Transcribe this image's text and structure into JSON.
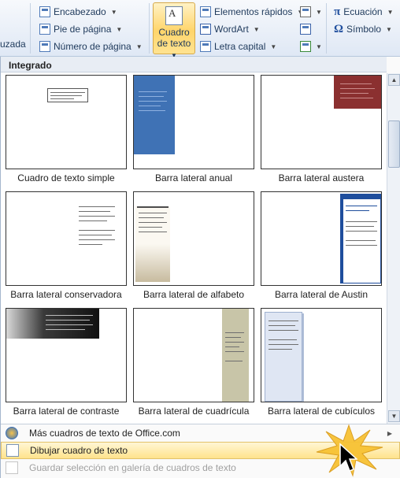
{
  "ribbon": {
    "partial_left_label": "uzada",
    "header_footer": [
      {
        "label": "Encabezado",
        "icon": "header-icon"
      },
      {
        "label": "Pie de página",
        "icon": "footer-icon"
      },
      {
        "label": "Número de página",
        "icon": "page-number-icon"
      }
    ],
    "text_box_button": {
      "line1": "Cuadro",
      "line2": "de texto"
    },
    "text_group": [
      {
        "label": "Elementos rápidos",
        "icon": "quick-parts-icon"
      },
      {
        "label": "WordArt",
        "icon": "wordart-icon"
      },
      {
        "label": "Letra capital",
        "icon": "drop-cap-icon"
      }
    ],
    "symbols": [
      {
        "label": "Ecuación",
        "glyph": "π"
      },
      {
        "label": "Símbolo",
        "glyph": "Ω"
      }
    ]
  },
  "gallery": {
    "section_title": "Integrado",
    "tiles": [
      {
        "label": "Cuadro de texto simple"
      },
      {
        "label": "Barra lateral anual"
      },
      {
        "label": "Barra lateral austera"
      },
      {
        "label": "Barra lateral conservadora"
      },
      {
        "label": "Barra lateral de alfabeto"
      },
      {
        "label": "Barra lateral de Austin"
      },
      {
        "label": "Barra lateral de contraste"
      },
      {
        "label": "Barra lateral de cuadrícula"
      },
      {
        "label": "Barra lateral de cubículos"
      }
    ]
  },
  "menu": {
    "more": "Más cuadros de texto de Office.com",
    "draw": "Dibujar cuadro de texto",
    "save": "Guardar selección en galería de cuadros de texto"
  },
  "colors": {
    "hover": "#ffe38c",
    "annual_sidebar": "#3f72b5",
    "austere_box": "#8b3030",
    "austin_bar": "#1f4e9d",
    "grid_bar": "#c8c5a8",
    "cubicles_bar": "#dfe6f3"
  }
}
